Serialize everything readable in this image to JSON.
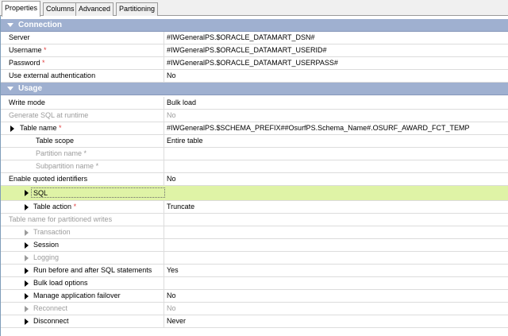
{
  "tabs": [
    "Properties",
    "Columns",
    "Advanced",
    "Partitioning"
  ],
  "sections": {
    "connection": "Connection",
    "usage": "Usage"
  },
  "props": {
    "server": {
      "label": "Server",
      "value": "#IWGeneralPS.$ORACLE_DATAMART_DSN#"
    },
    "username": {
      "label": "Username",
      "value": "#IWGeneralPS.$ORACLE_DATAMART_USERID#"
    },
    "password": {
      "label": "Password",
      "value": "#IWGeneralPS.$ORACLE_DATAMART_USERPASS#"
    },
    "use_ext_auth": {
      "label": "Use external authentication",
      "value": "No"
    },
    "write_mode": {
      "label": "Write mode",
      "value": "Bulk load"
    },
    "generate_sql": {
      "label": "Generate SQL at runtime",
      "value": "No"
    },
    "table_name": {
      "label": "Table name",
      "value": "#IWGeneralPS.$SCHEMA_PREFIX##OsurfPS.Schema_Name#.OSURF_AWARD_FCT_TEMP"
    },
    "table_scope": {
      "label": "Table scope",
      "value": "Entire table"
    },
    "partition_name": {
      "label": "Partition name",
      "value": ""
    },
    "subpartition_name": {
      "label": "Subpartition name",
      "value": ""
    },
    "quoted_ids": {
      "label": "Enable quoted identifiers",
      "value": "No"
    },
    "sql": {
      "label": "SQL",
      "value": ""
    },
    "table_action": {
      "label": "Table action",
      "value": "Truncate"
    },
    "table_name_partitioned": {
      "label": "Table name for partitioned writes",
      "value": ""
    },
    "transaction": {
      "label": "Transaction",
      "value": ""
    },
    "session": {
      "label": "Session",
      "value": ""
    },
    "logging": {
      "label": "Logging",
      "value": ""
    },
    "run_before_after": {
      "label": "Run before and after SQL statements",
      "value": "Yes"
    },
    "bulk_load_options": {
      "label": "Bulk load options",
      "value": ""
    },
    "manage_failover": {
      "label": "Manage application failover",
      "value": "No"
    },
    "reconnect": {
      "label": "Reconnect",
      "value": "No"
    },
    "disconnect": {
      "label": "Disconnect",
      "value": "Never"
    }
  },
  "required_marker": "*"
}
